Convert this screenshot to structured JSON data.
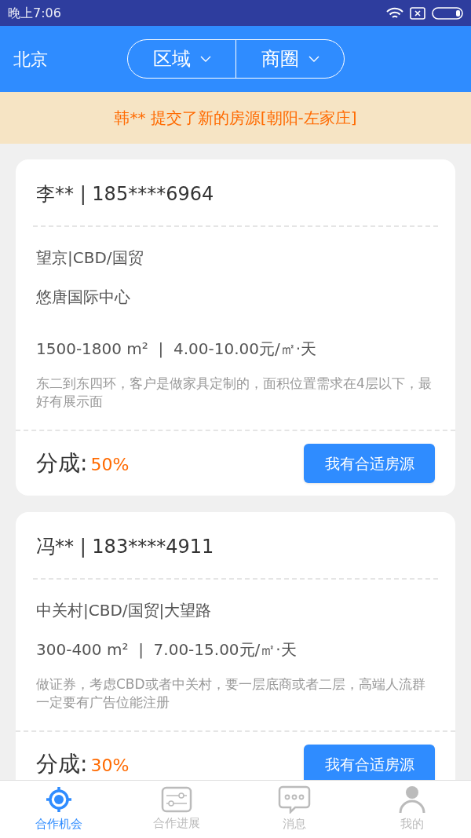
{
  "status_bar": {
    "time": "晚上7:06"
  },
  "header": {
    "city": "北京",
    "filters": [
      {
        "label": "区域"
      },
      {
        "label": "商圈"
      }
    ]
  },
  "notice": "韩** 提交了新的房源[朝阳-左家庄]",
  "cards": [
    {
      "contact": "李** | 185****6964",
      "area": "望京|CBD/国贸",
      "building": "悠唐国际中心",
      "size_price": "1500-1800 m²  |  4.00-10.00元/㎡·天",
      "note": "东二到东四环，客户是做家具定制的，面积位置需求在4层以下，最好有展示面",
      "share_label": "分成:",
      "share_value": "50%",
      "button": "我有合适房源"
    },
    {
      "contact": "冯** | 183****4911",
      "area": "中关村|CBD/国贸|大望路",
      "size_price": "300-400 m²  |  7.00-15.00元/㎡·天",
      "note": "做证券，考虑CBD或者中关村，要一层底商或者二层，高端人流群一定要有广告位能注册",
      "share_label": "分成:",
      "share_value": "30%",
      "button": "我有合适房源"
    }
  ],
  "tabs": [
    {
      "kind": "target",
      "label": "合作机会",
      "selected": true
    },
    {
      "kind": "sliders",
      "label": "合作进展",
      "selected": false
    },
    {
      "kind": "chat",
      "label": "消息",
      "selected": false
    },
    {
      "kind": "person",
      "label": "我的",
      "selected": false
    }
  ]
}
